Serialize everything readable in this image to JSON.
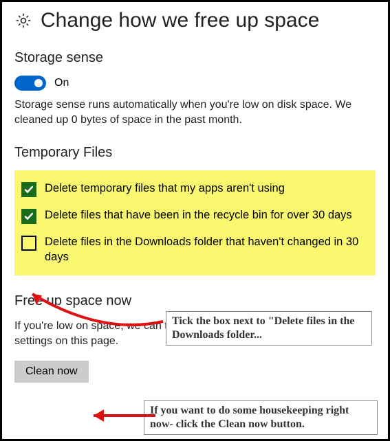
{
  "header": {
    "title": "Change how we free up space"
  },
  "storage_sense": {
    "heading": "Storage sense",
    "toggle_label": "On",
    "desc": "Storage sense runs automatically when you're low on disk space. We cleaned up 0 bytes of space in the past month."
  },
  "temp_files": {
    "heading": "Temporary Files",
    "options": [
      {
        "label": "Delete temporary files that my apps aren't using",
        "checked": true
      },
      {
        "label": "Delete files that have been in the recycle bin for over 30 days",
        "checked": true
      },
      {
        "label": "Delete files in the Downloads folder that haven't changed in 30 days",
        "checked": false
      }
    ]
  },
  "free_up": {
    "heading": "Free up space now",
    "desc": "If you're low on space, we can try to clean up files now using the settings on this page.",
    "button": "Clean now"
  },
  "callouts": {
    "c1": "Tick the box next to \"Delete files in the Downloads folder...",
    "c2": "If you want to do some housekeeping right now- click the Clean now button."
  },
  "colors": {
    "accent": "#0066cc",
    "highlight": "#faf86e",
    "check_bg": "#1a6b1a",
    "arrow": "#d11"
  }
}
